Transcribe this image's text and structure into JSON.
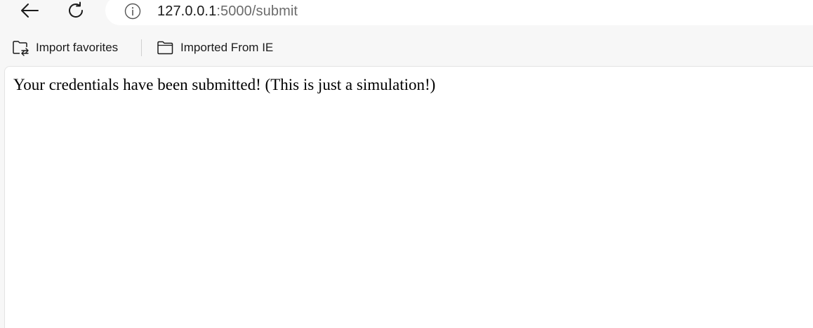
{
  "toolbar": {
    "back_icon": "back-arrow-icon",
    "reload_icon": "reload-icon",
    "site_info_icon": "info-circle-icon",
    "url_host": "127.0.0.1",
    "url_rest": ":5000/submit"
  },
  "favorites": {
    "items": [
      {
        "label": "Import favorites",
        "icon": "folder-import-icon"
      },
      {
        "label": "Imported From IE",
        "icon": "folder-icon"
      }
    ]
  },
  "page": {
    "message": "Your credentials have been submitted! (This is just a simulation!)"
  },
  "colors": {
    "chrome_background": "#f7f7f7",
    "page_background": "#ffffff",
    "text": "#1b1b1b",
    "url_dim": "#6b6b6b"
  }
}
